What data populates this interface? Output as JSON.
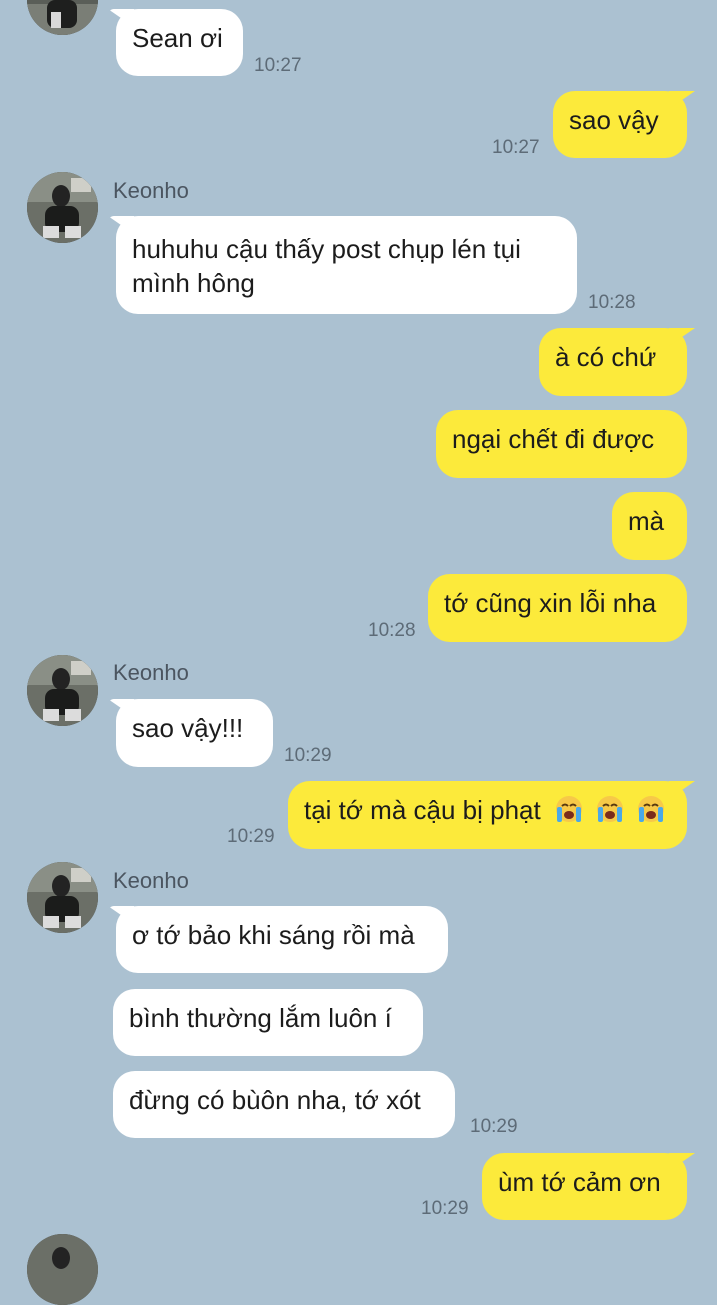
{
  "contact": {
    "name": "Keonho"
  },
  "messages": [
    {
      "text": "Sean ơi",
      "time": "10:27"
    },
    {
      "text": "sao vậy",
      "time": "10:27"
    },
    {
      "text": "huhuhu cậu thấy post chụp lén tụi mình hông",
      "time": "10:28"
    },
    {
      "text": "à có chứ"
    },
    {
      "text": "ngại chết đi được"
    },
    {
      "text": "mà"
    },
    {
      "text": "tớ cũng xin lỗi nha",
      "time": "10:28"
    },
    {
      "text": "sao vậy!!!",
      "time": "10:29"
    },
    {
      "text": "tại tớ mà cậu bị phạt",
      "emoji": "😭😭😭",
      "time": "10:29"
    },
    {
      "text": "ơ tớ bảo khi sáng rồi mà"
    },
    {
      "text": "bình thường lắm luôn í"
    },
    {
      "text": "đừng có bùôn nha, tớ xót",
      "time": "10:29"
    },
    {
      "text": "ùm tớ cảm ơn",
      "time": "10:29"
    }
  ],
  "colors": {
    "background": "#abc1d1",
    "incoming_bubble": "#ffffff",
    "outgoing_bubble": "#fcea3b"
  },
  "icons": {
    "avatar": "contact-avatar-photo",
    "emoji": "loudly-crying-face-icon"
  }
}
